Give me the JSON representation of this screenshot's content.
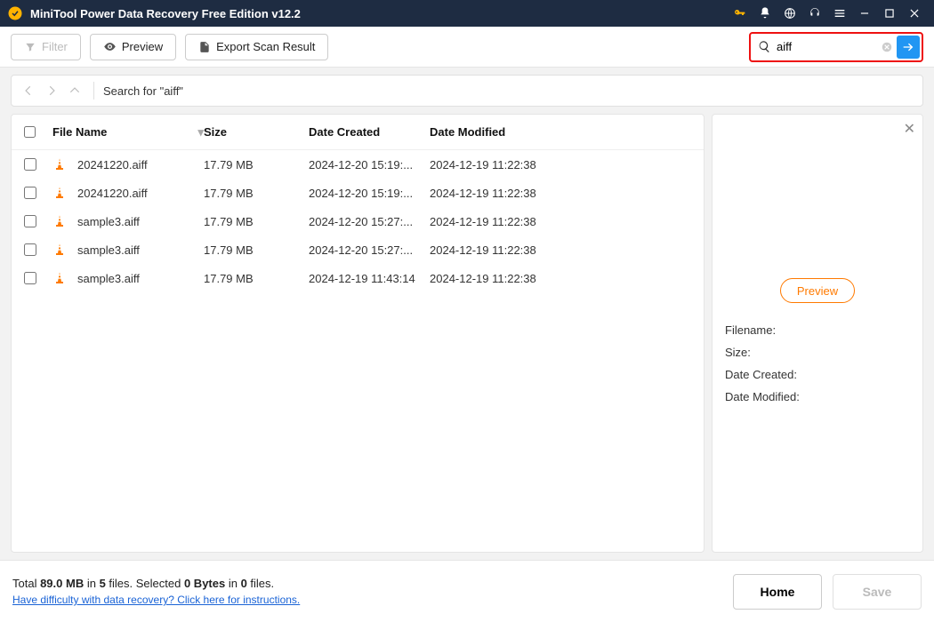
{
  "titlebar": {
    "title": "MiniTool Power Data Recovery Free Edition v12.2"
  },
  "toolbar": {
    "filter_label": "Filter",
    "preview_label": "Preview",
    "export_label": "Export Scan Result"
  },
  "search": {
    "value": "aiff",
    "placeholder": ""
  },
  "breadcrumb": {
    "label": "Search for  \"aiff\""
  },
  "columns": {
    "name": "File Name",
    "size": "Size",
    "created": "Date Created",
    "modified": "Date Modified"
  },
  "files": [
    {
      "name": "20241220.aiff",
      "size": "17.79 MB",
      "created": "2024-12-20 15:19:...",
      "modified": "2024-12-19 11:22:38"
    },
    {
      "name": "20241220.aiff",
      "size": "17.79 MB",
      "created": "2024-12-20 15:19:...",
      "modified": "2024-12-19 11:22:38"
    },
    {
      "name": "sample3.aiff",
      "size": "17.79 MB",
      "created": "2024-12-20 15:27:...",
      "modified": "2024-12-19 11:22:38"
    },
    {
      "name": "sample3.aiff",
      "size": "17.79 MB",
      "created": "2024-12-20 15:27:...",
      "modified": "2024-12-19 11:22:38"
    },
    {
      "name": "sample3.aiff",
      "size": "17.79 MB",
      "created": "2024-12-19 11:43:14",
      "modified": "2024-12-19 11:22:38"
    }
  ],
  "detail": {
    "preview_label": "Preview",
    "filename_label": "Filename:",
    "size_label": "Size:",
    "created_label": "Date Created:",
    "modified_label": "Date Modified:"
  },
  "bottom": {
    "total_prefix": "Total ",
    "total_size": "89.0 MB",
    "in_word": " in ",
    "total_files": "5",
    "files_word": " files.  ",
    "selected_word": "Selected ",
    "sel_bytes": "0 Bytes",
    "in_word2": " in ",
    "sel_files": "0",
    "files_word2": " files.",
    "help_link": "Have difficulty with data recovery? Click here for instructions.",
    "home_label": "Home",
    "save_label": "Save"
  }
}
